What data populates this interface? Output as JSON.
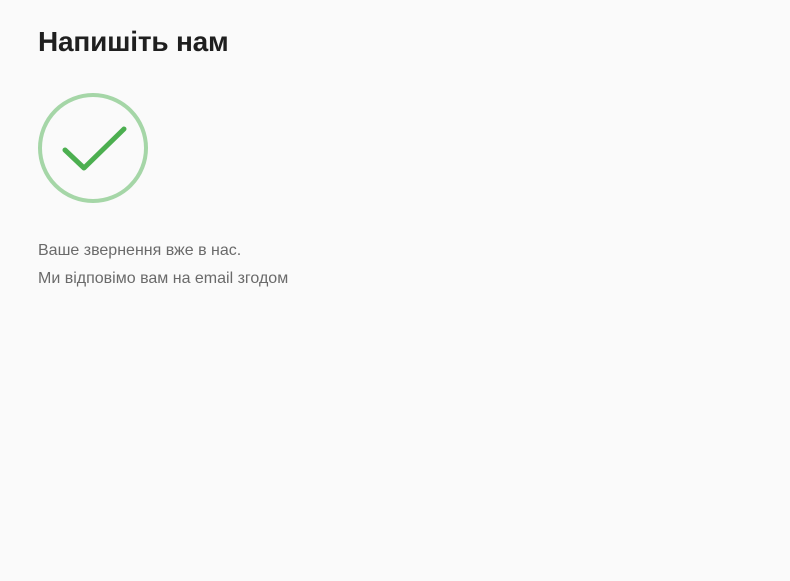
{
  "contact": {
    "title": "Напишіть нам",
    "success_icon": "check-circle-icon",
    "message_line_1": "Ваше звернення вже в нас.",
    "message_line_2": "Ми відповімо вам на email згодом"
  },
  "colors": {
    "background": "#fafafa",
    "title": "#1f1f1f",
    "text": "#6a6a6a",
    "check": "#4caf50",
    "circle": "#a5d6a7"
  }
}
